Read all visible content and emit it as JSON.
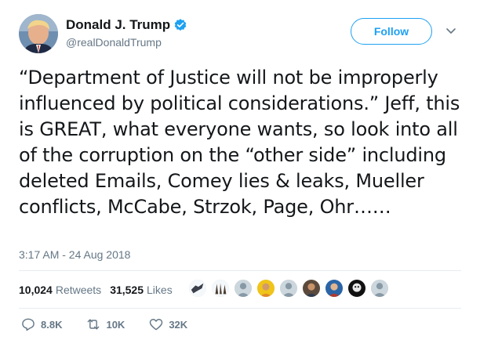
{
  "user": {
    "display_name": "Donald J. Trump",
    "handle": "@realDonaldTrump",
    "verified": true,
    "avatar_icon": "profile-photo"
  },
  "follow_button": {
    "label": "Follow"
  },
  "menu_icon": "chevron-down-icon",
  "tweet": {
    "text": "“Department of Justice will not be improperly influenced by political considerations.” Jeff, this is GREAT, what everyone wants, so look into all of the corruption on the “other side” including deleted Emails, Comey lies & leaks, Mueller conflicts, McCabe, Strzok, Page, Ohr……",
    "timestamp": "3:17 AM - 24 Aug 2018"
  },
  "stats": {
    "retweets_count": "10,024",
    "retweets_label": "Retweets",
    "likes_count": "31,525",
    "likes_label": "Likes"
  },
  "liker_faces_count": 10,
  "actions": {
    "reply_count": "8.8K",
    "retweet_count": "10K",
    "like_count": "32K"
  },
  "colors": {
    "accent": "#1da1f2",
    "muted": "#657786",
    "text": "#14171a",
    "divider": "#e6ecf0"
  }
}
